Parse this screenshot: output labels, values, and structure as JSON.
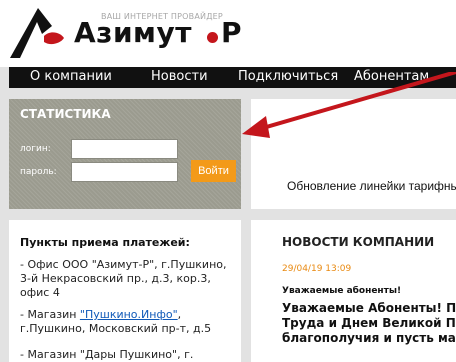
{
  "header": {
    "tagline": "ВАШ ИНТЕРНЕТ ПРОВАЙДЕР",
    "brand_main": "Азимут",
    "brand_suffix": "Р"
  },
  "nav": {
    "items": [
      "О компании",
      "Новости",
      "Подключиться",
      "Абонентам"
    ]
  },
  "stats": {
    "title": "СТАТИСТИКА",
    "login_label": "логин:",
    "password_label": "пароль:",
    "login_value": "",
    "password_value": "",
    "submit_label": "Войти"
  },
  "banner": {
    "text": "Обновление линейки тарифных"
  },
  "payments": {
    "title": "Пункты приема платежей:",
    "item1": "- Офис ООО \"Азимут-Р\", г.Пушкино, 3-й Некрасовский пр., д.3, кор.3, офис 4",
    "item2_prefix": "- Магазин ",
    "item2_link": "\"Пушкино.Инфо\"",
    "item2_suffix": ", г.Пушкино, Московский пр-т, д.5",
    "item3": "- Магазин \"Дары Пушкино\", г."
  },
  "news": {
    "title": "НОВОСТИ КОМПАНИИ",
    "date": "29/04/19 13:09",
    "headline": "Уважаемые абоненты!",
    "body_line1": "Уважаемые Абоненты! Поз",
    "body_line2": "Труда и Днем Великой По",
    "body_line3": "благополучия и пусть май"
  },
  "colors": {
    "nav_bg": "#111111",
    "stats_bg": "#9b9b8f",
    "accent_orange": "#f39a19",
    "brand_red": "#c4161c",
    "arrow_red": "#c4161c",
    "link_blue": "#0f59b8"
  },
  "icons": [
    "logo-mark-icon",
    "annotation-arrow-icon"
  ]
}
